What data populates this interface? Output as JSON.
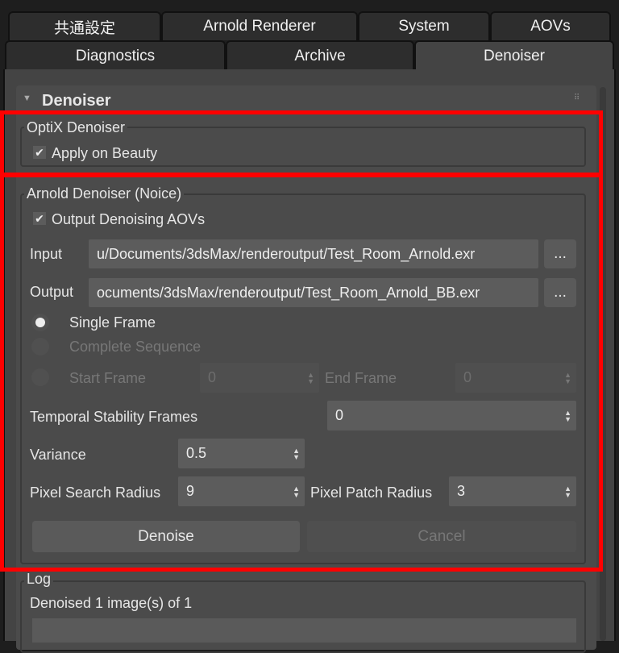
{
  "tabs_row1": [
    {
      "label": "共通設定"
    },
    {
      "label": "Arnold Renderer"
    },
    {
      "label": "System"
    },
    {
      "label": "AOVs"
    }
  ],
  "tabs_row2": [
    {
      "label": "Diagnostics"
    },
    {
      "label": "Archive"
    },
    {
      "label": "Denoiser",
      "active": true
    }
  ],
  "rollout": {
    "title": "Denoiser"
  },
  "optix": {
    "title": "OptiX Denoiser",
    "apply_on_beauty": {
      "label": "Apply on Beauty",
      "checked": true
    }
  },
  "arnold": {
    "title": "Arnold Denoiser (Noice)",
    "output_aovs": {
      "label": "Output Denoising AOVs",
      "checked": true
    },
    "input": {
      "label": "Input",
      "value": "u/Documents/3dsMax/renderoutput/Test_Room_Arnold.exr",
      "browse": "..."
    },
    "output": {
      "label": "Output",
      "value": "ocuments/3dsMax/renderoutput/Test_Room_Arnold_BB.exr",
      "browse": "..."
    },
    "mode": {
      "single_frame": "Single Frame",
      "complete_sequence": "Complete Sequence",
      "start_frame": "Start Frame",
      "selected": "Single Frame"
    },
    "start_frame_value": "0",
    "end_frame": {
      "label": "End Frame",
      "value": "0"
    },
    "temporal": {
      "label": "Temporal Stability Frames",
      "value": "0"
    },
    "variance": {
      "label": "Variance",
      "value": "0.5"
    },
    "search_radius": {
      "label": "Pixel Search Radius",
      "value": "9"
    },
    "patch_radius": {
      "label": "Pixel Patch Radius",
      "value": "3"
    },
    "denoise_button": "Denoise",
    "cancel_button": "Cancel"
  },
  "log": {
    "title": "Log",
    "message": "Denoised 1 image(s) of 1"
  },
  "colors": {
    "highlight": "#ff0000",
    "panel": "#444444",
    "tab_inactive": "#2d2d2d"
  }
}
